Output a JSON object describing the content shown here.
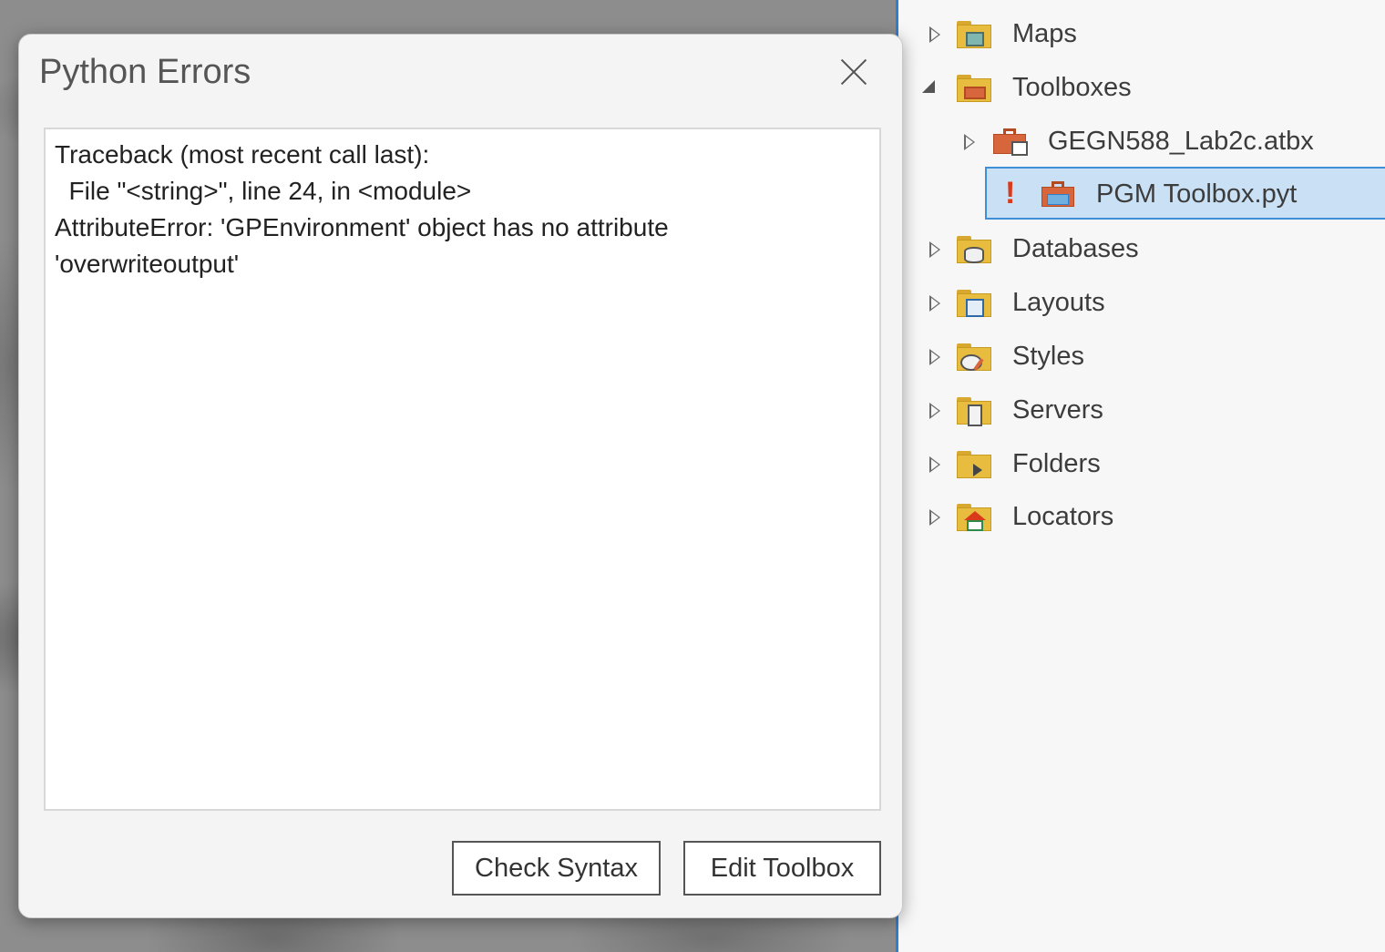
{
  "dialog": {
    "title": "Python Errors",
    "error_lines": [
      "Traceback (most recent call last):",
      "  File \"<string>\", line 24, in <module>",
      "AttributeError: 'GPEnvironment' object has no attribute",
      "'overwriteoutput'"
    ],
    "buttons": {
      "check_syntax": "Check Syntax",
      "edit_toolbox": "Edit Toolbox"
    }
  },
  "catalog": {
    "items": [
      {
        "label": "Maps",
        "icon": "maps-folder-icon",
        "expanded": false
      },
      {
        "label": "Toolboxes",
        "icon": "toolboxes-folder-icon",
        "expanded": true
      },
      {
        "label": "GEGN588_Lab2c.atbx",
        "icon": "home-toolbox-icon",
        "expanded": false
      },
      {
        "label": "PGM Toolbox.pyt",
        "icon": "python-toolbox-icon",
        "selected": true,
        "status": "!"
      },
      {
        "label": "Databases",
        "icon": "databases-folder-icon",
        "expanded": false
      },
      {
        "label": "Layouts",
        "icon": "layouts-folder-icon",
        "expanded": false
      },
      {
        "label": "Styles",
        "icon": "styles-folder-icon",
        "expanded": false
      },
      {
        "label": "Servers",
        "icon": "servers-folder-icon",
        "expanded": false
      },
      {
        "label": "Folders",
        "icon": "folders-folder-icon",
        "expanded": false
      },
      {
        "label": "Locators",
        "icon": "locators-folder-icon",
        "expanded": false
      }
    ]
  },
  "colors": {
    "accent": "#3f8fd8",
    "selection": "#c9e0f5",
    "error": "#d93a1a",
    "folder": "#e8bd3f",
    "toolbox": "#d8663c"
  }
}
